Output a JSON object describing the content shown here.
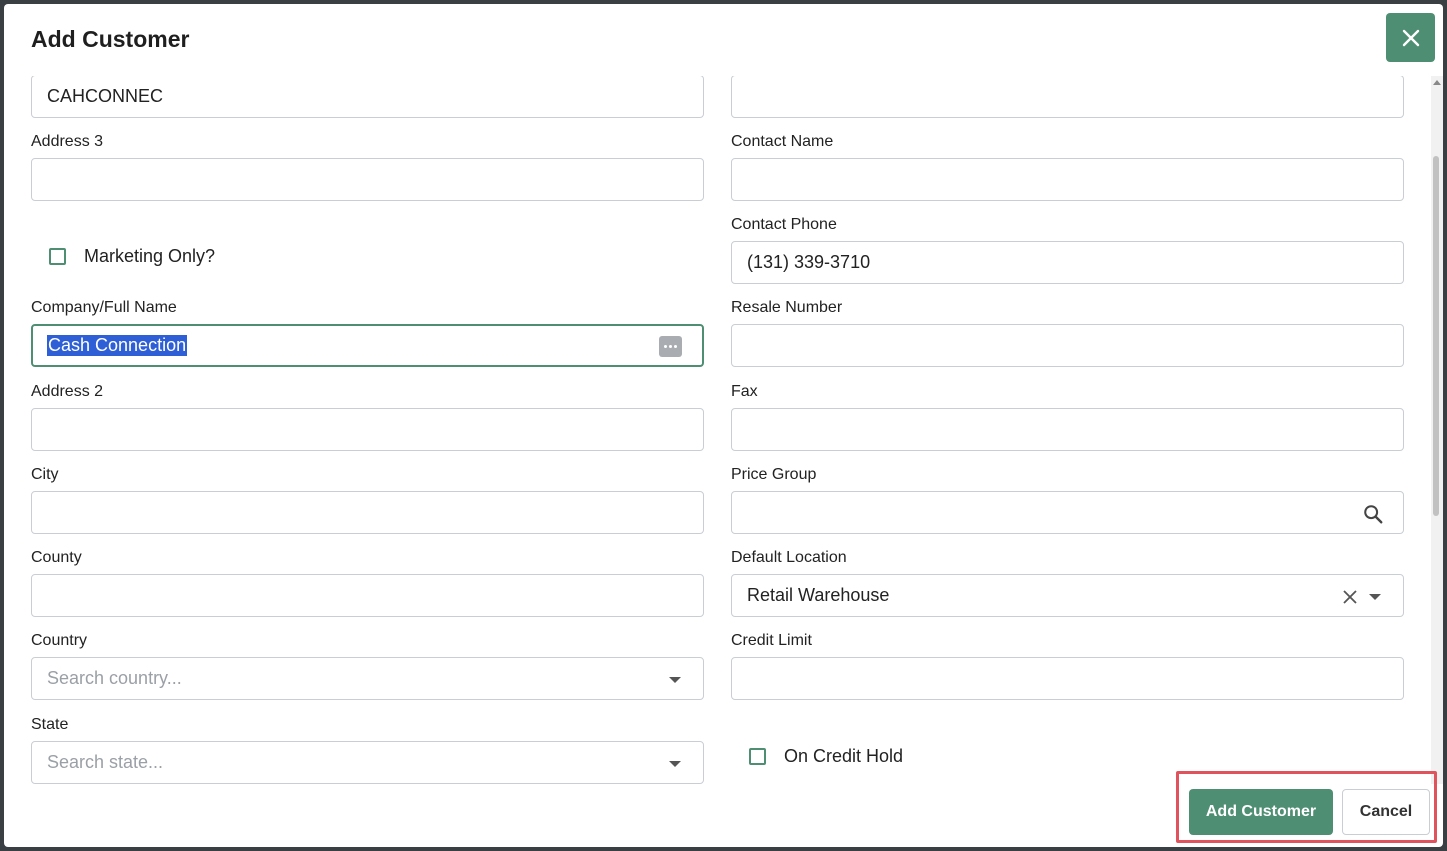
{
  "dialog": {
    "title": "Add Customer",
    "close_icon": "close-icon"
  },
  "left": {
    "customer_code": {
      "value": "CAHCONNEC"
    },
    "address3": {
      "label": "Address 3",
      "value": ""
    },
    "marketing_only": {
      "label": "Marketing Only?",
      "checked": false
    },
    "company_name": {
      "label": "Company/Full Name",
      "value": "Cash Connection",
      "selected": true
    },
    "address2": {
      "label": "Address 2",
      "value": ""
    },
    "city": {
      "label": "City",
      "value": ""
    },
    "county": {
      "label": "County",
      "value": ""
    },
    "country": {
      "label": "Country",
      "placeholder": "Search country..."
    },
    "state": {
      "label": "State",
      "placeholder": "Search state..."
    }
  },
  "right": {
    "top_field": {
      "value": ""
    },
    "contact_name": {
      "label": "Contact Name",
      "value": ""
    },
    "contact_phone": {
      "label": "Contact Phone",
      "value": "(131) 339-3710"
    },
    "resale_number": {
      "label": "Resale Number",
      "value": ""
    },
    "fax": {
      "label": "Fax",
      "value": ""
    },
    "price_group": {
      "label": "Price Group",
      "value": "",
      "icon": "search-icon"
    },
    "default_location": {
      "label": "Default Location",
      "value": "Retail Warehouse"
    },
    "credit_limit": {
      "label": "Credit Limit",
      "value": ""
    },
    "on_credit_hold": {
      "label": "On Credit Hold",
      "checked": false
    }
  },
  "footer": {
    "add_label": "Add Customer",
    "cancel_label": "Cancel"
  },
  "colors": {
    "accent": "#4e8e73",
    "highlight": "#e0535d"
  }
}
